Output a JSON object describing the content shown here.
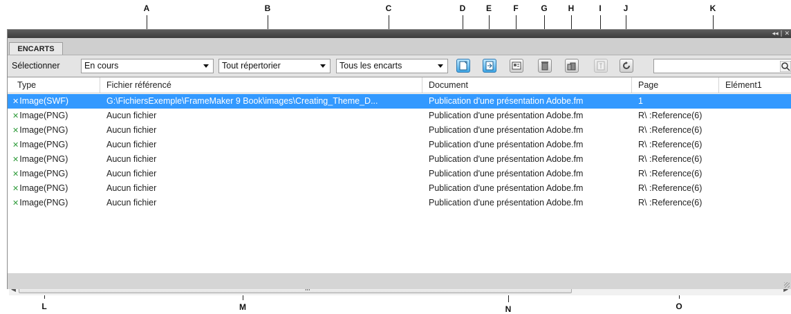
{
  "callouts": {
    "top": [
      "A",
      "B",
      "C",
      "D",
      "E",
      "F",
      "G",
      "H",
      "I",
      "J",
      "K"
    ],
    "bottom": [
      "L",
      "M",
      "N",
      "O"
    ]
  },
  "panel": {
    "tab_label": "ENCARTS",
    "collapse_glyph": "◂◂ | ✕"
  },
  "toolbar": {
    "select_label": "Sélectionner",
    "dropdown_status": "En cours",
    "dropdown_list": "Tout répertorier",
    "dropdown_scope": "Tous les encarts",
    "search_value": ""
  },
  "table": {
    "columns": [
      "Type",
      "Fichier référencé",
      "Document",
      "Page",
      "Elément1"
    ],
    "rows": [
      {
        "type": "Image(SWF)",
        "file": "G:\\FichiersExemple\\FrameMaker 9 Book\\images\\Creating_Theme_D...",
        "document": "Publication d'une présentation Adobe.fm",
        "page": "1",
        "selected": true
      },
      {
        "type": "Image(PNG)",
        "file": "Aucun fichier",
        "document": "Publication d'une présentation Adobe.fm",
        "page": "R\\ :Reference(6)",
        "selected": false
      },
      {
        "type": "Image(PNG)",
        "file": "Aucun fichier",
        "document": "Publication d'une présentation Adobe.fm",
        "page": "R\\ :Reference(6)",
        "selected": false
      },
      {
        "type": "Image(PNG)",
        "file": "Aucun fichier",
        "document": "Publication d'une présentation Adobe.fm",
        "page": "R\\ :Reference(6)",
        "selected": false
      },
      {
        "type": "Image(PNG)",
        "file": "Aucun fichier",
        "document": "Publication d'une présentation Adobe.fm",
        "page": "R\\ :Reference(6)",
        "selected": false
      },
      {
        "type": "Image(PNG)",
        "file": "Aucun fichier",
        "document": "Publication d'une présentation Adobe.fm",
        "page": "R\\ :Reference(6)",
        "selected": false
      },
      {
        "type": "Image(PNG)",
        "file": "Aucun fichier",
        "document": "Publication d'une présentation Adobe.fm",
        "page": "R\\ :Reference(6)",
        "selected": false
      },
      {
        "type": "Image(PNG)",
        "file": "Aucun fichier",
        "document": "Publication d'une présentation Adobe.fm",
        "page": "R\\ :Reference(6)",
        "selected": false
      }
    ]
  },
  "icons": {
    "toolbar": [
      "new-inset-icon",
      "import-inset-icon",
      "properties-icon",
      "delete-icon",
      "delete-all-icon",
      "edit-disabled-icon",
      "refresh-icon"
    ],
    "type_marker": "✕",
    "scroll_grip": "III"
  },
  "colors": {
    "selection": "#3399ff",
    "type_marker": "#2e9b3a",
    "titlebar": "#4a4a4a"
  }
}
